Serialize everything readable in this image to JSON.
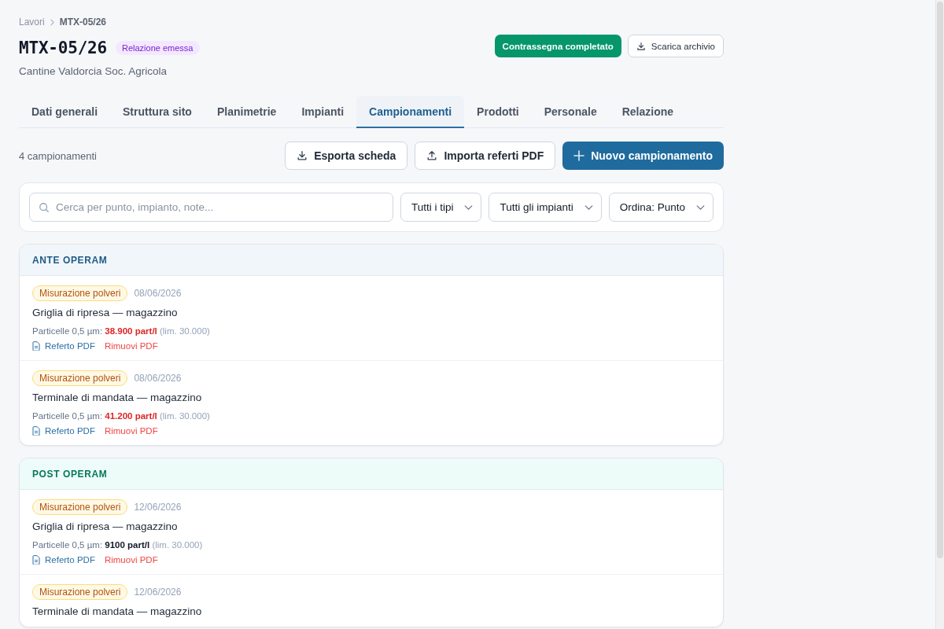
{
  "breadcrumb": [
    {
      "label": "Lavori"
    },
    {
      "label": "MTX-05/26"
    }
  ],
  "header": {
    "title": "MTX-05/26",
    "status_badge": "Relazione emessa",
    "subtitle": "Cantine Valdorcia Soc. Agricola",
    "actions": [
      {
        "label": "Contrassegna completato",
        "kind": "success"
      },
      {
        "label": "Scarica archivio",
        "kind": "download"
      }
    ]
  },
  "tabs": [
    {
      "label": "Dati generali",
      "selected": false
    },
    {
      "label": "Struttura sito",
      "selected": false
    },
    {
      "label": "Planimetrie",
      "selected": false
    },
    {
      "label": "Impianti",
      "selected": false
    },
    {
      "label": "Campionamenti",
      "selected": true
    },
    {
      "label": "Prodotti",
      "selected": false
    },
    {
      "label": "Personale",
      "selected": false
    },
    {
      "label": "Relazione",
      "selected": false
    }
  ],
  "toolbar": {
    "count": "4 campionamenti",
    "actions": [
      {
        "label": "Esporta scheda",
        "kind": "download"
      },
      {
        "label": "Importa referti PDF",
        "kind": "upload"
      },
      {
        "label": "Nuovo campionamento",
        "kind": "primary"
      }
    ]
  },
  "filters": {
    "search": {
      "placeholder": "Cerca per punto, impianto, note..."
    },
    "selects": [
      {
        "value": "Tutti i tipi"
      },
      {
        "value": "Tutti gli impianti"
      },
      {
        "value": "Ordina: Punto"
      }
    ]
  },
  "groups": [
    {
      "title": "ANTE OPERAM",
      "color": "#1e5a86",
      "items": [
        {
          "type_badge": "Misurazione polveri",
          "date": "08/06/2026",
          "title": "Griglia di ripresa — magazzino",
          "parameter": "Particelle 0,5 µm:",
          "value": "38.900 part/l",
          "limit": "(lim. 30.000)",
          "exceeded": true,
          "links": [
            {
              "label": "Referto PDF",
              "kind": "view"
            },
            {
              "label": "Rimuovi PDF",
              "kind": "remove"
            }
          ]
        },
        {
          "type_badge": "Misurazione polveri",
          "date": "08/06/2026",
          "title": "Terminale di mandata — magazzino",
          "parameter": "Particelle 0,5 µm:",
          "value": "41.200 part/l",
          "limit": "(lim. 30.000)",
          "exceeded": true,
          "links": [
            {
              "label": "Referto PDF",
              "kind": "view"
            },
            {
              "label": "Rimuovi PDF",
              "kind": "remove"
            }
          ]
        }
      ]
    },
    {
      "title": "POST OPERAM",
      "color": "#047857",
      "items": [
        {
          "type_badge": "Misurazione polveri",
          "date": "12/06/2026",
          "title": "Griglia di ripresa — magazzino",
          "parameter": "Particelle 0,5 µm:",
          "value": "9100 part/l",
          "limit": "(lim. 30.000)",
          "exceeded": false,
          "links": [
            {
              "label": "Referto PDF",
              "kind": "view"
            },
            {
              "label": "Rimuovi PDF",
              "kind": "remove"
            }
          ]
        },
        {
          "type_badge": "Misurazione polveri",
          "date": "12/06/2026",
          "title": "Terminale di mandata — magazzino"
        }
      ]
    }
  ]
}
